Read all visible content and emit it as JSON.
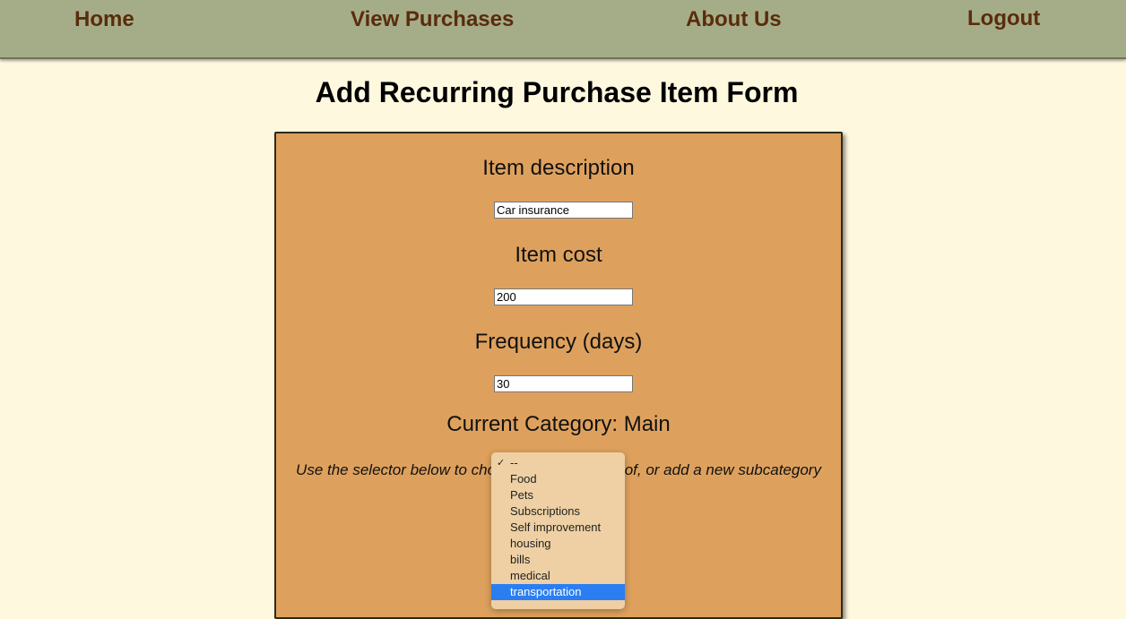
{
  "nav": {
    "home": "Home",
    "view_purchases": "View Purchases",
    "about_us": "About Us",
    "logout": "Logout"
  },
  "page_title": "Add Recurring Purchase Item Form",
  "form": {
    "description_label": "Item description",
    "description_value": "Car insurance",
    "cost_label": "Item cost",
    "cost_value": "200",
    "frequency_label": "Frequency (days)",
    "frequency_value": "30",
    "category_label": "Current Category: Main",
    "hint": "Use the selector below to choose a subcategory of, or add a new subcategory"
  },
  "dropdown": {
    "checked_option": "--",
    "options": [
      "--",
      "Food",
      "Pets",
      "Subscriptions",
      "Self improvement",
      "housing",
      "bills",
      "medical",
      "transportation"
    ],
    "highlighted_option": "transportation"
  },
  "colors": {
    "navbar": "#a5ad88",
    "nav_text": "#5a2c0c",
    "page_background": "#fef8df",
    "form_background": "#dea15d",
    "dropdown_background": "#eed0a4",
    "highlight": "#2a7ef2"
  }
}
